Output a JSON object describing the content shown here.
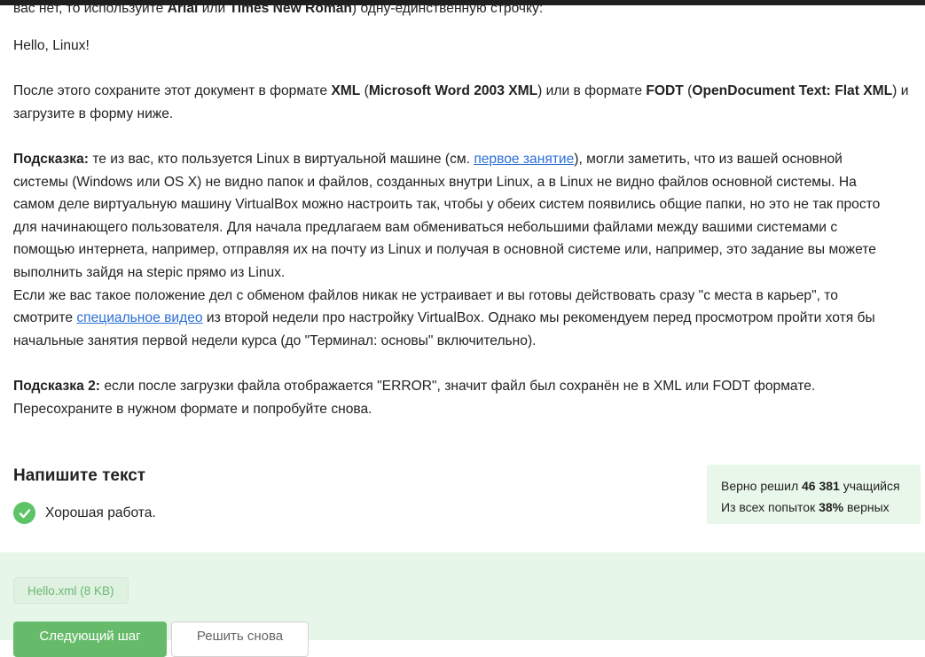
{
  "instructions": {
    "line0_text_a": "вас нет, то используйте ",
    "line0_font1": "Arial",
    "line0_or": " или ",
    "line0_font2": "Times New Roman",
    "line0_text_b": ") одну-единственную строчку:",
    "hello_line": "Hello, Linux!",
    "save_a": "После этого сохраните этот документ в формате ",
    "save_xml": "XML",
    "save_paren1": " (",
    "save_word_xml": "Microsoft Word 2003 XML",
    "save_b": ") или в формате ",
    "save_fodt": "FODT",
    "save_paren2": " (",
    "save_odt": "OpenDocument Text: Flat XML",
    "save_c": ") и",
    "save_line2": "загрузите в форму ниже."
  },
  "hint1": {
    "label": "Подсказка:",
    "text_a": " те из вас, кто пользуется Linux в виртуальной машине (см. ",
    "link1": "первое занятие",
    "text_b": "), могли заметить, что из вашей основной",
    "line2": "системы (Windows или OS X) не видно папок и файлов, созданных внутри Linux, а в Linux не видно файлов основной системы. На",
    "line3": "самом деле виртуальную машину VirtualBox можно настроить так, чтобы у обеих систем появились общие папки, но это не так просто",
    "line4": "для начинающего пользователя. Для начала предлагаем вам обмениваться небольшими файлами между вашими системами с",
    "line5": "помощью интернета, например, отправляя их на почту из Linux и получая в основной системе или, например, это задание вы можете",
    "line6": "выполнить зайдя на stepic прямо из Linux.",
    "line7": "Если же вас такое положение дел с обменом файлов никак не устраивает и вы готовы действовать сразу \"с места в карьер\", то",
    "line8_a": "смотрите ",
    "link2": "специальное видео",
    "line8_b": " из второй недели про настройку VirtualBox. Однако мы рекомендуем перед просмотром пройти хотя бы",
    "line9": "начальные занятия первой недели курса (до \"Терминал: основы\" включительно)."
  },
  "hint2": {
    "label": "Подсказка 2:",
    "text_a": " если после загрузки файла отображается \"ERROR\", значит файл был сохранён не в XML или FODT формате.",
    "line2": "Пересохраните в нужном формате и попробуйте снова."
  },
  "task": {
    "title": "Напишите текст",
    "success_message": "Хорошая работа."
  },
  "stats": {
    "solved_prefix": "Верно решил ",
    "solved_count": "46 381",
    "solved_suffix": " учащийся",
    "attempts_prefix": "Из всех попыток ",
    "attempts_percent": "38%",
    "attempts_suffix": " верных"
  },
  "submission": {
    "file_label": "Hello.xml (8 KB)",
    "next_button": "Следующий шаг",
    "retry_button": "Решить снова"
  }
}
